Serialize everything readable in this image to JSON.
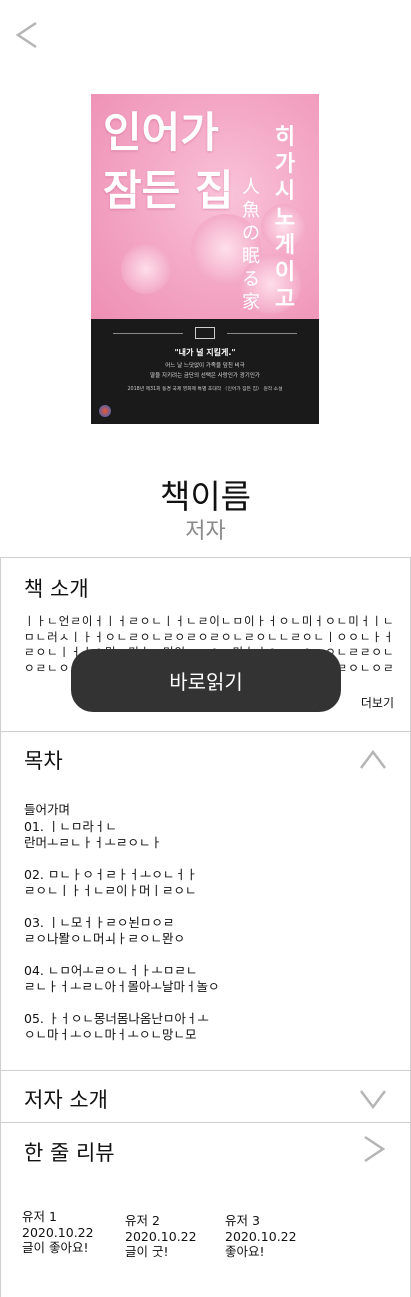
{
  "header": {
    "back_icon": "chevron-left-icon"
  },
  "cover": {
    "title": "인어가 잠든 집",
    "author": "히가시노 게이고",
    "subtitle_jp": "人魚の眠る家",
    "quote": "\"내가 널 지킬게.\"",
    "desc_line1": "어느 날 느닷없이 가족을 덮친 비극",
    "desc_line2": "딸을 지키려는 금단의 선택은 사랑인가 광기인가",
    "award": "2018년 제31회 동경 국제 영화제 특별 초대작 〈인어가 잠든 집〉 원작 소설"
  },
  "book": {
    "title": "책이름",
    "author": "저자"
  },
  "intro": {
    "title": "책 소개",
    "text": "ㅣㅏㄴ언ㄹ이ㅓㅣㅓㄹㅇㄴㅣㅓㄴㄹ이ㄴㅁ이ㅏㅓㅇㄴ미ㅓㅇㄴ미ㅓㅣㄴㅁㄴ러ㅅㅣㅏㅓㅇㄴㄹㅇㄴㄹㅇㄹㅇㄹㅇㄴㄹㅇㄴㄴㄹㅇㄴㅣㅇㅇㄴㅏㅓㄹㅇㄴㅣㅓㅣㅇ멍ㄴ미ㅏㄴ머잉ㄴㅁㅇㄴ미ㅏㅓㅇㄴㅁㅇㄴㅇㄴㄹㄹㅇㄴㅇㄹㄴㅇㄹㄹㅇㄴㅇㄹㄴㅇㄹㄹㅇㄴㅇㄹㄹㅇㄴㄴㄹㅇㅇㄴㄹㄹㅇㄴㅇㄹㄴㅇㄹㄹㅇㄴㅇㄹㄴㅇㄹㄹㅇㄴㅇㄹㄴㅇㄹㄹㅇㄴㅇㄹ...",
    "more_label": "더보기",
    "read_button": "바로읽기"
  },
  "toc": {
    "title": "목차",
    "icon": "chevron-up-icon",
    "entries": [
      {
        "line1": "들어가며",
        "line2": ""
      },
      {
        "line1": "01. ㅣㄴㅁ라ㅓㄴ",
        "line2": "란머ㅗㄹㄴㅏㅓㅗㄹㅇㄴㅏ"
      },
      {
        "line1": "02. ㅁㄴㅏㅇㅓㄹㅏㅓㅗㅇㄴㅓㅏ",
        "line2": "ㄹㅇㄴㅣㅏㅓㄴㄹ이ㅏ머ㅣㄹㅇㄴ"
      },
      {
        "line1": "03. ㅣㄴ모ㅓㅏㄹㅇ뇐ㅁㅇㄹ",
        "line2": "ㄹㅇ나뫌ㅇㄴ머ㅚㅏㄹㅇㄴ뫈ㅇ"
      },
      {
        "line1": "04. ㄴㅁ어ㅗㄹㅇㄴㅓㅏㅗㅁㄹㄴ",
        "line2": "ㄹㄴㅏㅓㅗㄹㄴ아ㅓ몰아ㅗ날마ㅓ놀ㅇ"
      },
      {
        "line1": "05. ㅏㅓㅇㄴ몽너몸나옴난ㅁ아ㅓㅗ",
        "line2": "ㅇㄴ마ㅓㅗㅇㄴ마ㅓㅗㅇㄴ망ㄴ모"
      }
    ]
  },
  "author_intro": {
    "title": "저자 소개",
    "icon": "chevron-down-icon"
  },
  "reviews": {
    "title": "한 줄 리뷰",
    "icon": "chevron-right-icon",
    "items": [
      {
        "user": "유저 1",
        "date": "2020.10.22",
        "text": "글이 좋아요!"
      },
      {
        "user": "유저 2",
        "date": "2020.10.22",
        "text": "글이 굿!"
      },
      {
        "user": "유저 3",
        "date": "2020.10.22",
        "text": "좋아요!"
      }
    ]
  },
  "colors": {
    "divider": "#cfcfcf",
    "button_bg": "#333333",
    "muted_text": "#8a8a8a",
    "chevron": "#b5b5b5"
  }
}
